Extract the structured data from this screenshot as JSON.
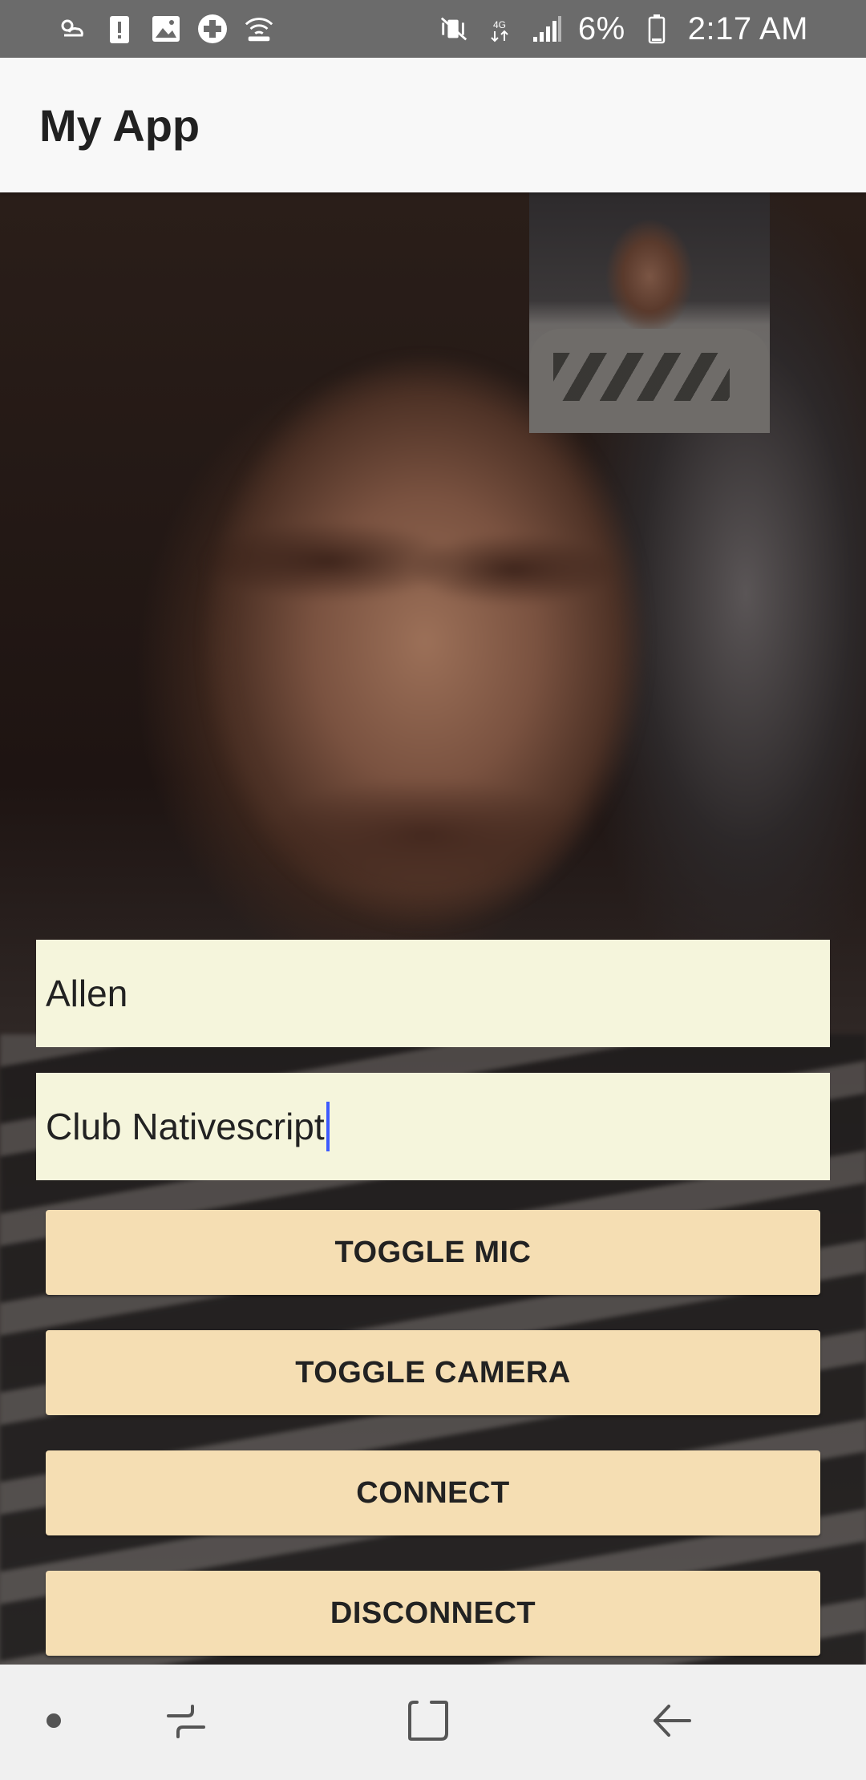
{
  "status_bar": {
    "battery_percent": "6%",
    "time": "2:17 AM",
    "left_icons": [
      "weather-icon",
      "alert-icon",
      "image-icon",
      "health-icon",
      "wifi-call-icon"
    ],
    "right_icons": [
      "vibrate-mute-icon",
      "lte-data-icon",
      "signal-icon",
      "battery-icon"
    ]
  },
  "app_bar": {
    "title": "My App"
  },
  "form": {
    "name_value": "Allen",
    "room_value": "Club Nativescript"
  },
  "buttons": {
    "toggle_mic": "TOGGLE MIC",
    "toggle_camera": "TOGGLE CAMERA",
    "connect": "CONNECT",
    "disconnect": "DISCONNECT"
  },
  "nav_bar": {
    "items": [
      "dot-icon",
      "recents-icon",
      "home-icon",
      "back-icon"
    ]
  },
  "colors": {
    "status_bar": "#6b6b6b",
    "app_bar": "#f8f8f8",
    "field_bg": "#f5f5dc",
    "button_bg": "#f5deb3",
    "caret": "#3d5afe",
    "nav_bar": "#f0f0f0"
  }
}
